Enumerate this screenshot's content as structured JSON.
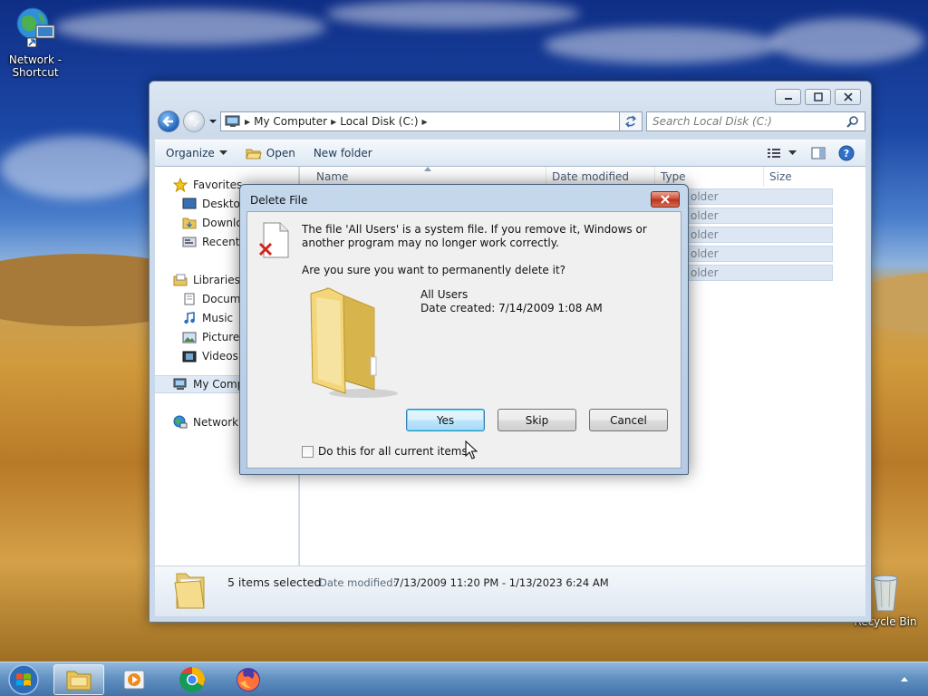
{
  "desktop": {
    "icons": [
      {
        "label": "Network - Shortcut"
      },
      {
        "label": "Recycle Bin"
      }
    ]
  },
  "explorer": {
    "address": {
      "crumbs": [
        "My Computer",
        "Local Disk (C:)"
      ]
    },
    "search": {
      "placeholder": "Search Local Disk (C:)"
    },
    "commands": {
      "organize": "Organize",
      "open": "Open",
      "new_folder": "New folder"
    },
    "nav": {
      "favorites": "Favorites",
      "desktop": "Desktop",
      "downloads": "Downlo",
      "recent": "Recent P",
      "libraries": "Libraries",
      "documents": "Docume",
      "music": "Music",
      "pictures": "Pictures",
      "videos": "Videos",
      "computer": "My Comp",
      "network": "Network"
    },
    "columns": {
      "name": "Name",
      "date_modified": "Date modified",
      "type": "Type",
      "size": "Size"
    },
    "rows": [
      "older",
      "older",
      "older",
      "older",
      "older"
    ],
    "details": {
      "selected": "5 items selected",
      "date_label": "Date modified:",
      "date_value": "7/13/2009 11:20 PM - 1/13/2023 6:24 AM"
    }
  },
  "dialog": {
    "title": "Delete File",
    "message": "The file 'All Users' is a system file. If you remove it, Windows or another program may no longer work correctly.",
    "question": "Are you sure you want to permanently delete it?",
    "file_name": "All Users",
    "file_date": "Date created: 7/14/2009 1:08 AM",
    "buttons": {
      "yes": "Yes",
      "skip": "Skip",
      "cancel": "Cancel"
    },
    "checkbox": "Do this for all current items"
  },
  "colors": {
    "accent": "#3c7fb1",
    "close_red": "#c9462e"
  }
}
